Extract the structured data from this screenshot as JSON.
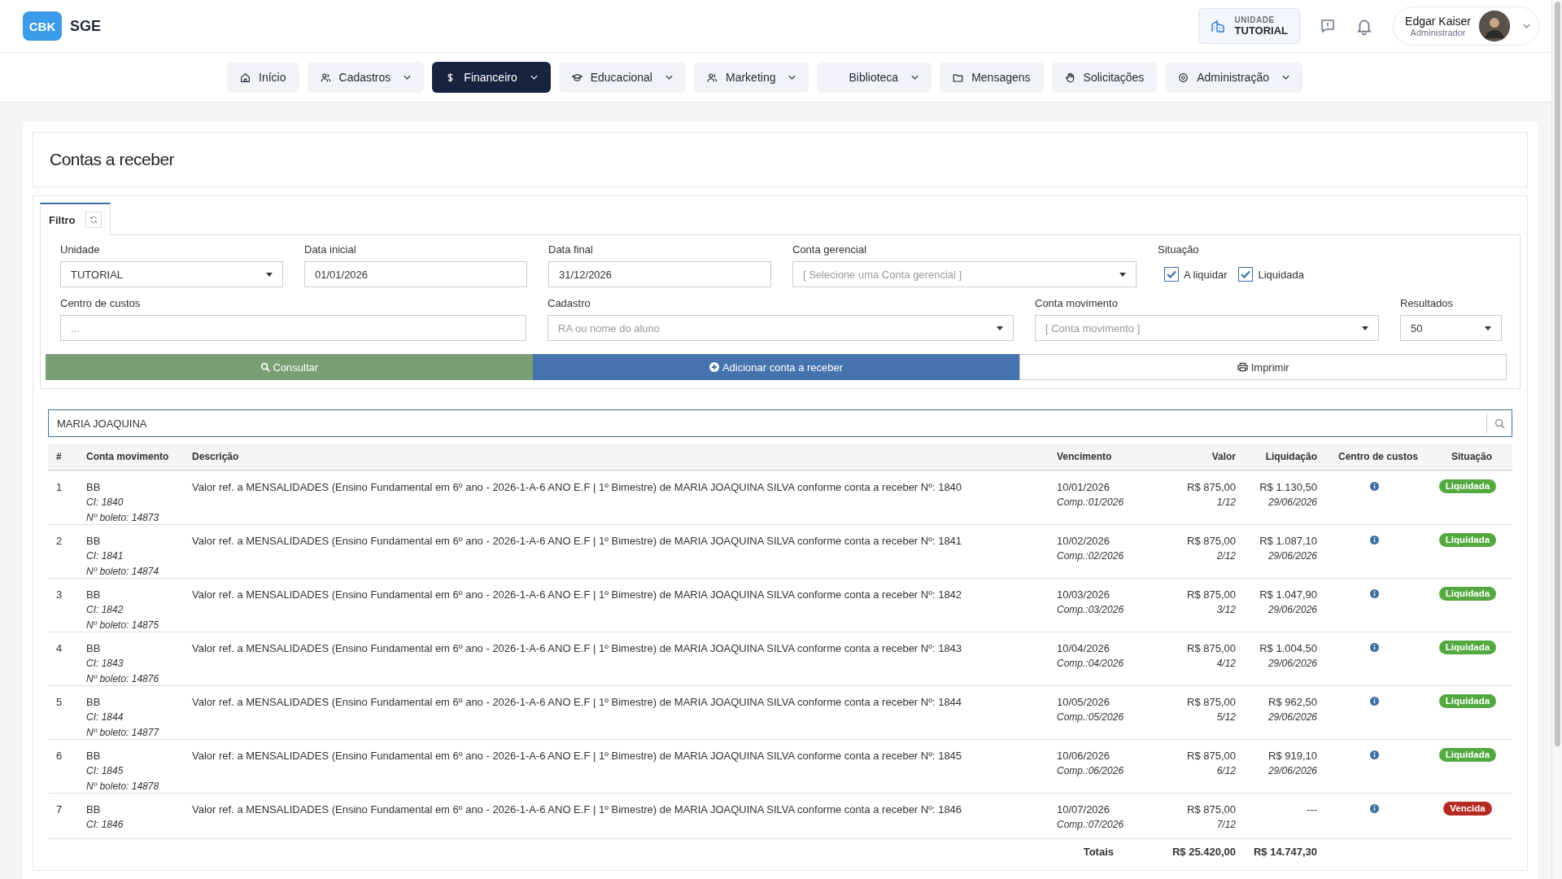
{
  "header": {
    "logo_badge": "CBK",
    "app_name": "SGE",
    "unit": {
      "label": "UNIDADE",
      "value": "TUTORIAL"
    },
    "user": {
      "name": "Edgar Kaiser",
      "role": "Administrador"
    }
  },
  "nav": [
    {
      "label": "Início",
      "dropdown": false,
      "selected": false
    },
    {
      "label": "Cadastros",
      "dropdown": true,
      "selected": false
    },
    {
      "label": "Financeiro",
      "dropdown": true,
      "selected": true
    },
    {
      "label": "Educacional",
      "dropdown": true,
      "selected": false
    },
    {
      "label": "Marketing",
      "dropdown": true,
      "selected": false
    },
    {
      "label": "Biblioteca",
      "dropdown": true,
      "selected": false
    },
    {
      "label": "Mensagens",
      "dropdown": false,
      "selected": false
    },
    {
      "label": "Solicitações",
      "dropdown": false,
      "selected": false
    },
    {
      "label": "Administração",
      "dropdown": true,
      "selected": false
    }
  ],
  "page_title": "Contas a receber",
  "filter": {
    "tab": "Filtro",
    "fields": [
      {
        "kind": "select",
        "label": "Unidade",
        "value": "TUTORIAL"
      },
      {
        "kind": "text",
        "label": "Data inicial",
        "value": "01/01/2026"
      },
      {
        "kind": "text",
        "label": "Data final",
        "value": "31/12/2026"
      },
      {
        "kind": "select",
        "label": "Conta gerencial",
        "placeholder": "[ Selecione uma Conta gerencial ]"
      },
      {
        "kind": "checks",
        "label": "Situação",
        "options": [
          {
            "label": "A liquidar",
            "checked": true
          },
          {
            "label": "Liquidada",
            "checked": true
          }
        ]
      },
      {
        "kind": "text",
        "label": "Centro de custos",
        "placeholder": "..."
      },
      {
        "kind": "select",
        "label": "Cadastro",
        "placeholder": "RA ou nome do aluno"
      },
      {
        "kind": "select",
        "label": "Conta movimento",
        "placeholder": "[ Conta movimento ]"
      },
      {
        "kind": "select",
        "label": "Resultados",
        "value": "50"
      }
    ],
    "buttons": [
      {
        "label": "Consultar",
        "kind": "success"
      },
      {
        "label": "Adicionar conta a receber",
        "kind": "primary"
      },
      {
        "label": "Imprimir",
        "kind": "default"
      }
    ]
  },
  "search": {
    "value": "MARIA JOAQUINA"
  },
  "table": {
    "columns": [
      "#",
      "Conta movimento",
      "Descrição",
      "Vencimento",
      "Valor",
      "Liquidação",
      "Centro de custos",
      "Situação"
    ],
    "rows": [
      {
        "num": "1",
        "conta": "BB",
        "ci": "CI: 1840",
        "boleto": "Nº boleto: 14873",
        "descricao": "Valor ref. a MENSALIDADES (Ensino Fundamental em 6º ano - 2026-1-A-6 ANO E.F | 1º Bimestre) de MARIA JOAQUINA SILVA conforme conta a receber Nº: 1840",
        "vencimento": "10/01/2026",
        "comp": "Comp.:01/2026",
        "valor": "R$ 875,00",
        "parcela": "1/12",
        "liquidacao": "R$ 1.130,50",
        "data_liquidacao": "29/06/2026",
        "situacao": {
          "label": "Liquidada",
          "kind": "paid"
        }
      },
      {
        "num": "2",
        "conta": "BB",
        "ci": "CI: 1841",
        "boleto": "Nº boleto: 14874",
        "descricao": "Valor ref. a MENSALIDADES (Ensino Fundamental em 6º ano - 2026-1-A-6 ANO E.F | 1º Bimestre) de MARIA JOAQUINA SILVA conforme conta a receber Nº: 1841",
        "vencimento": "10/02/2026",
        "comp": "Comp.:02/2026",
        "valor": "R$ 875,00",
        "parcela": "2/12",
        "liquidacao": "R$ 1.087,10",
        "data_liquidacao": "29/06/2026",
        "situacao": {
          "label": "Liquidada",
          "kind": "paid"
        }
      },
      {
        "num": "3",
        "conta": "BB",
        "ci": "CI: 1842",
        "boleto": "Nº boleto: 14875",
        "descricao": "Valor ref. a MENSALIDADES (Ensino Fundamental em 6º ano - 2026-1-A-6 ANO E.F | 1º Bimestre) de MARIA JOAQUINA SILVA conforme conta a receber Nº: 1842",
        "vencimento": "10/03/2026",
        "comp": "Comp.:03/2026",
        "valor": "R$ 875,00",
        "parcela": "3/12",
        "liquidacao": "R$ 1.047,90",
        "data_liquidacao": "29/06/2026",
        "situacao": {
          "label": "Liquidada",
          "kind": "paid"
        }
      },
      {
        "num": "4",
        "conta": "BB",
        "ci": "CI: 1843",
        "boleto": "Nº boleto: 14876",
        "descricao": "Valor ref. a MENSALIDADES (Ensino Fundamental em 6º ano - 2026-1-A-6 ANO E.F | 1º Bimestre) de MARIA JOAQUINA SILVA conforme conta a receber Nº: 1843",
        "vencimento": "10/04/2026",
        "comp": "Comp.:04/2026",
        "valor": "R$ 875,00",
        "parcela": "4/12",
        "liquidacao": "R$ 1.004,50",
        "data_liquidacao": "29/06/2026",
        "situacao": {
          "label": "Liquidada",
          "kind": "paid"
        }
      },
      {
        "num": "5",
        "conta": "BB",
        "ci": "CI: 1844",
        "boleto": "Nº boleto: 14877",
        "descricao": "Valor ref. a MENSALIDADES (Ensino Fundamental em 6º ano - 2026-1-A-6 ANO E.F | 1º Bimestre) de MARIA JOAQUINA SILVA conforme conta a receber Nº: 1844",
        "vencimento": "10/05/2026",
        "comp": "Comp.:05/2026",
        "valor": "R$ 875,00",
        "parcela": "5/12",
        "liquidacao": "R$ 962,50",
        "data_liquidacao": "29/06/2026",
        "situacao": {
          "label": "Liquidada",
          "kind": "paid"
        }
      },
      {
        "num": "6",
        "conta": "BB",
        "ci": "CI: 1845",
        "boleto": "Nº boleto: 14878",
        "descricao": "Valor ref. a MENSALIDADES (Ensino Fundamental em 6º ano - 2026-1-A-6 ANO E.F | 1º Bimestre) de MARIA JOAQUINA SILVA conforme conta a receber Nº: 1845",
        "vencimento": "10/06/2026",
        "comp": "Comp.:06/2026",
        "valor": "R$ 875,00",
        "parcela": "6/12",
        "liquidacao": "R$ 919,10",
        "data_liquidacao": "29/06/2026",
        "situacao": {
          "label": "Liquidada",
          "kind": "paid"
        }
      },
      {
        "num": "7",
        "conta": "BB",
        "ci": "CI: 1846",
        "descricao": "Valor ref. a MENSALIDADES (Ensino Fundamental em 6º ano - 2026-1-A-6 ANO E.F | 1º Bimestre) de MARIA JOAQUINA SILVA conforme conta a receber Nº: 1846",
        "vencimento": "10/07/2026",
        "comp": "Comp.:07/2026",
        "valor": "R$ 875,00",
        "parcela": "7/12",
        "liquidacao": "---",
        "situacao": {
          "label": "Vencida",
          "kind": "overdue"
        }
      }
    ],
    "totals": {
      "label": "Totais",
      "valor": "R$ 25.420,00",
      "liquidacao": "R$ 14.747,30"
    }
  }
}
